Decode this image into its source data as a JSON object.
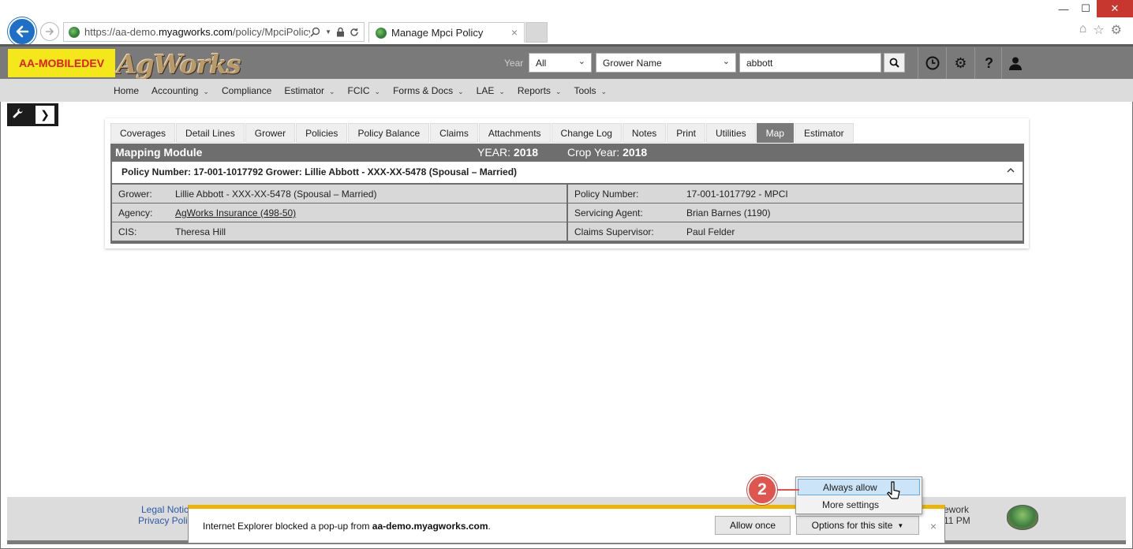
{
  "browser": {
    "url_prefix": "https://aa-demo.",
    "url_domain": "myagworks.com",
    "url_path": "/policy/MpciPolicy/",
    "tab_title": "Manage Mpci Policy",
    "tab_close": "×",
    "win_minimize": "—",
    "win_maximize": "☐",
    "win_close": "✕"
  },
  "header": {
    "env_badge": "AA-MOBILEDEV",
    "logo": "AgWorks",
    "year_label": "Year",
    "year_value": "All",
    "search_type": "Grower Name",
    "search_value": "abbott"
  },
  "nav": [
    {
      "label": "Home",
      "caret": false
    },
    {
      "label": "Accounting",
      "caret": true
    },
    {
      "label": "Compliance",
      "caret": false
    },
    {
      "label": "Estimator",
      "caret": true
    },
    {
      "label": "FCIC",
      "caret": true
    },
    {
      "label": "Forms & Docs",
      "caret": true
    },
    {
      "label": "LAE",
      "caret": true
    },
    {
      "label": "Reports",
      "caret": true
    },
    {
      "label": "Tools",
      "caret": true
    }
  ],
  "policy_tabs": [
    "Coverages",
    "Detail Lines",
    "Grower",
    "Policies",
    "Policy Balance",
    "Claims",
    "Attachments",
    "Change Log",
    "Notes",
    "Print",
    "Utilities",
    "Map",
    "Estimator"
  ],
  "active_tab": "Map",
  "module": {
    "title": "Mapping Module",
    "year_label": "YEAR:",
    "year_value": "2018",
    "crop_year_label": "Crop Year:",
    "crop_year_value": "2018"
  },
  "policy_header": "Policy Number: 17-001-1017792 Grower: Lillie Abbott - XXX-XX-5478 (Spousal – Married)",
  "info": {
    "grower_label": "Grower:",
    "grower_value": "Lillie Abbott - XXX-XX-5478 (Spousal – Married)",
    "policy_number_label": "Policy Number:",
    "policy_number_value": "17-001-1017792 - MPCI",
    "agency_label": "Agency:",
    "agency_value": "AgWorks Insurance (498-50)",
    "servicing_agent_label": "Servicing Agent:",
    "servicing_agent_value": "Brian Barnes (1190)",
    "cis_label": "CIS:",
    "cis_value": "Theresa Hill",
    "claims_supervisor_label": "Claims Supervisor:",
    "claims_supervisor_value": "Paul Felder"
  },
  "footer": {
    "legal": "Legal Notic",
    "privacy": "Privacy Poli",
    "right1": "ework",
    "right2": "11 PM"
  },
  "ie_bar": {
    "message_prefix": "Internet Explorer blocked a pop-up from ",
    "message_domain": "aa-demo.myagworks.com",
    "message_suffix": ".",
    "allow_once": "Allow once",
    "options": "Options for this site",
    "close": "×"
  },
  "dropdown": {
    "always_allow": "Always allow",
    "more_settings": "More settings"
  },
  "annotation": {
    "step": "2",
    "color": "#e0554e"
  },
  "colors": {
    "header_bg": "#7a7a7a",
    "env_badge_bg": "#f4e71a",
    "env_badge_text": "#e01e1e",
    "ie_bar_accent": "#f0b400",
    "back_button": "#1e6fc8"
  }
}
